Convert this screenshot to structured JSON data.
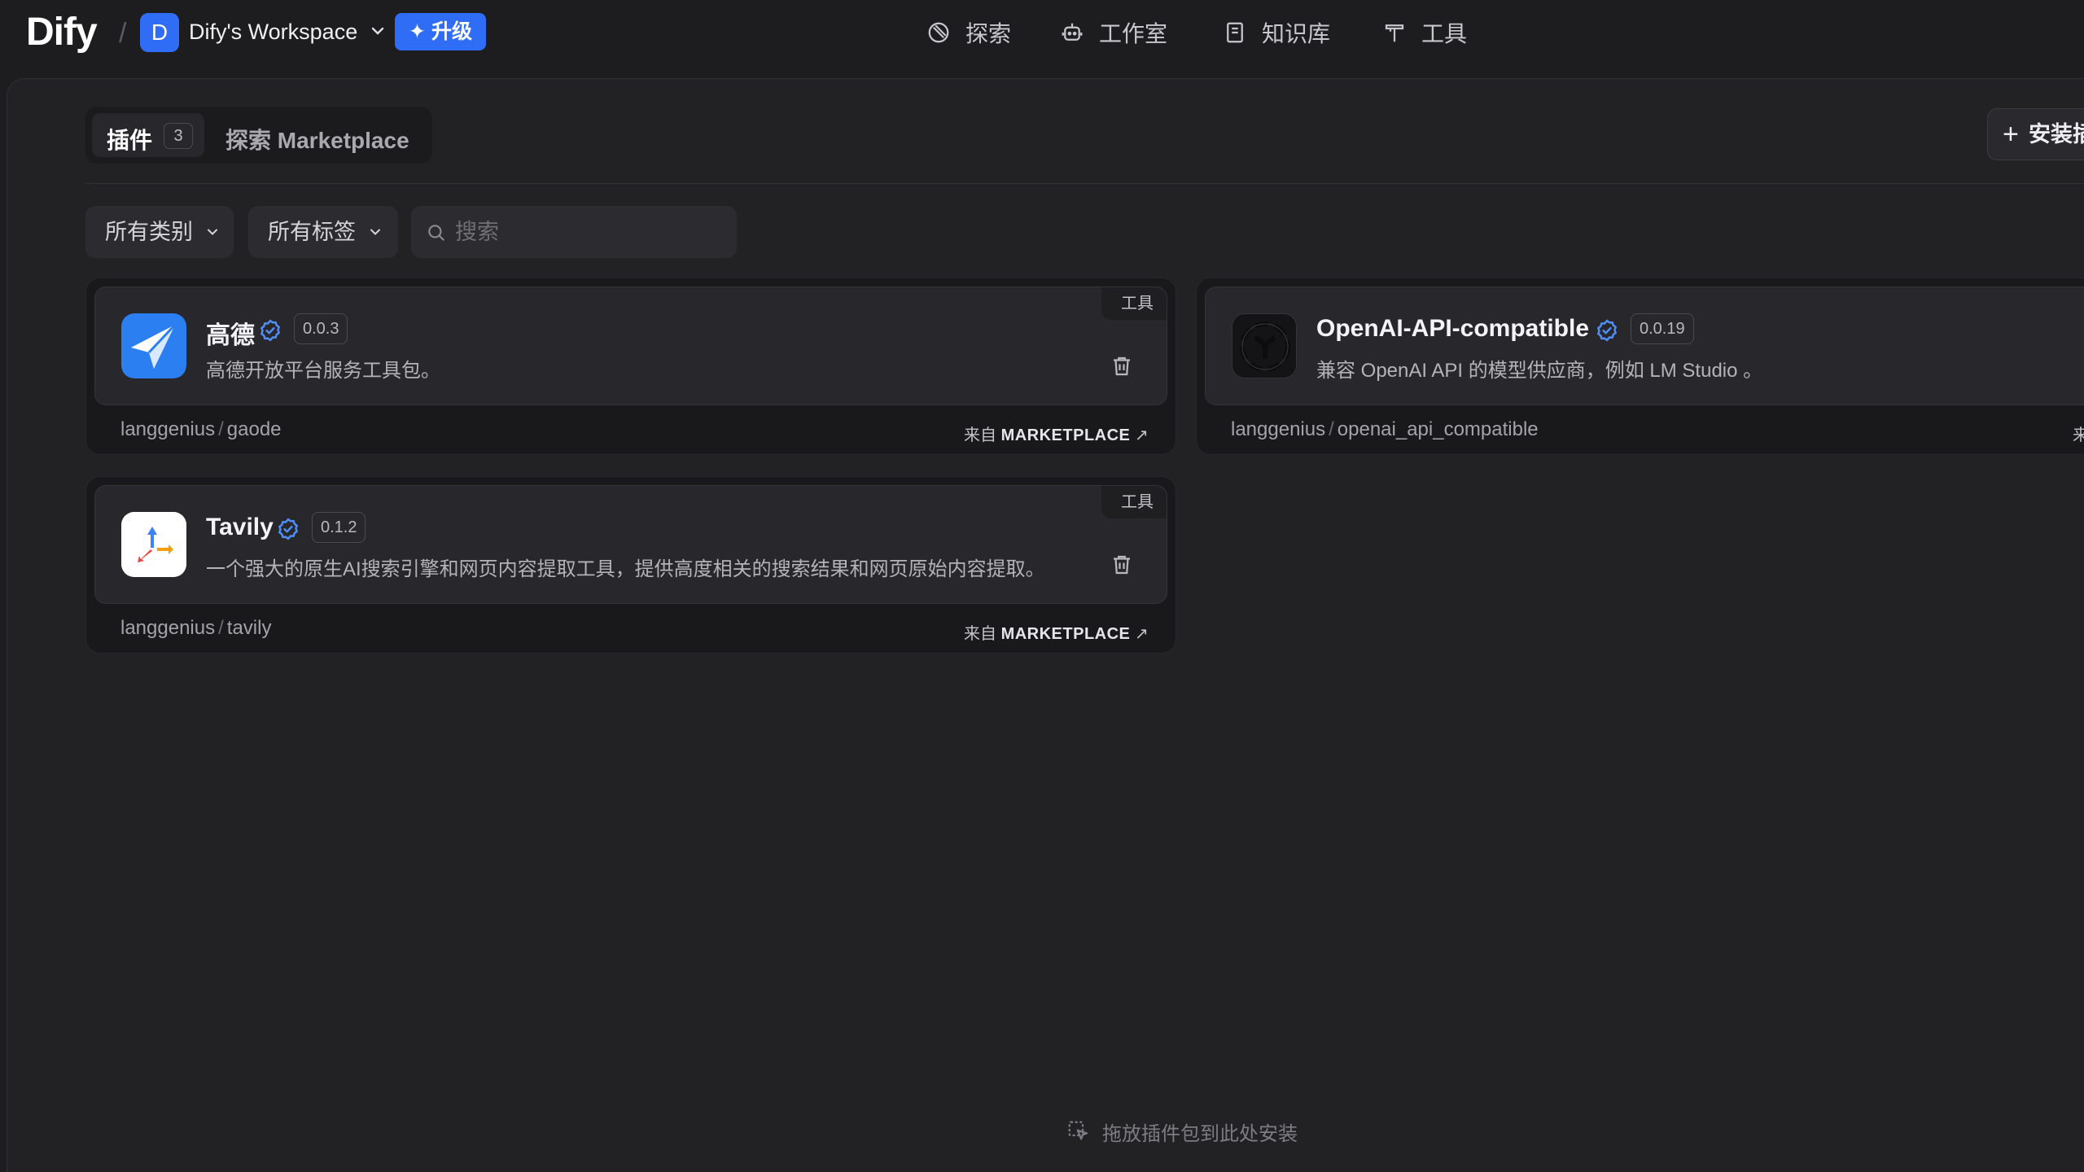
{
  "header": {
    "logo": "Dify",
    "workspace_initial": "D",
    "workspace_name": "Dify's Workspace",
    "upgrade_label": "升级",
    "nav": [
      {
        "label": "探索",
        "icon": "compass-icon"
      },
      {
        "label": "工作室",
        "icon": "robot-icon"
      },
      {
        "label": "知识库",
        "icon": "book-icon"
      },
      {
        "label": "工具",
        "icon": "hammer-icon"
      }
    ]
  },
  "tabs": {
    "plugins_label": "插件",
    "plugins_count": "3",
    "marketplace_label": "探索 Marketplace"
  },
  "install_button_label": "安装插",
  "filters": {
    "category_label": "所有类别",
    "tags_label": "所有标签",
    "search_placeholder": "搜索"
  },
  "plugins": [
    {
      "name": "高德",
      "version": "0.0.3",
      "description": "高德开放平台服务工具包。",
      "tag": "工具",
      "org": "langgenius",
      "slug": "gaode",
      "source_prefix": "来自",
      "source": "MARKETPLACE",
      "verified": true
    },
    {
      "name": "OpenAI-API-compatible",
      "version": "0.0.19",
      "description": "兼容 OpenAI API 的模型供应商，例如 LM Studio 。",
      "org": "langgenius",
      "slug": "openai_api_compatible",
      "source_prefix": "来",
      "verified": true
    },
    {
      "name": "Tavily",
      "version": "0.1.2",
      "description": "一个强大的原生AI搜索引擎和网页内容提取工具，提供高度相关的搜索结果和网页原始内容提取。",
      "tag": "工具",
      "org": "langgenius",
      "slug": "tavily",
      "source_prefix": "来自",
      "source": "MARKETPLACE",
      "verified": true
    }
  ],
  "org_separator": "/",
  "dropzone_label": "拖放插件包到此处安装",
  "colors": {
    "accent": "#2f6df6",
    "verified": "#4f8ef7",
    "background": "#1d1d20"
  }
}
